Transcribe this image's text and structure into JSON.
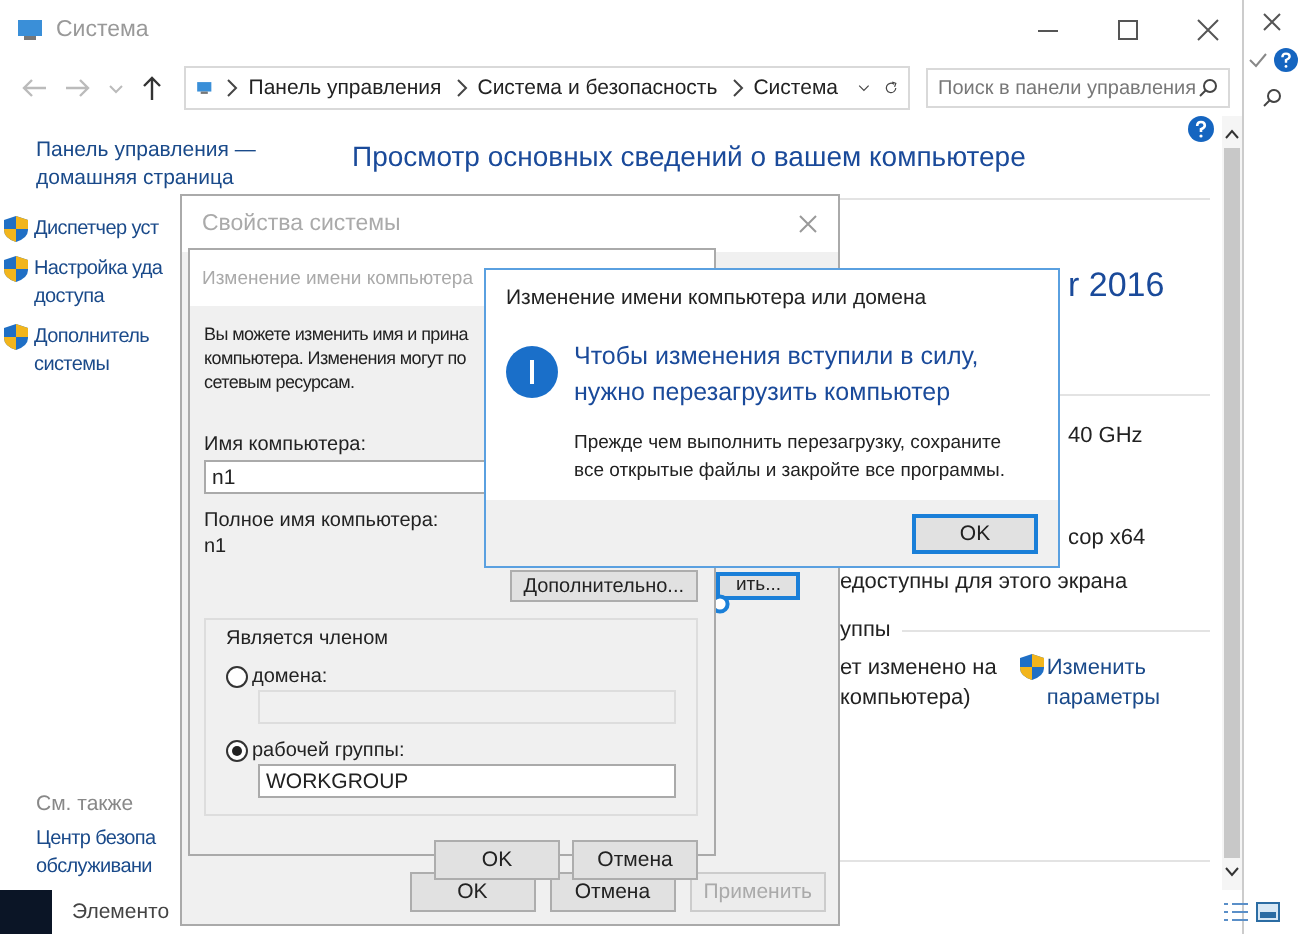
{
  "window": {
    "title": "Система"
  },
  "address_bar": {
    "breadcrumb": [
      "Панель управления",
      "Система и безопасность",
      "Система"
    ]
  },
  "search": {
    "placeholder": "Поиск в панели управления"
  },
  "sidebar": {
    "home_link": "Панель управления —\nдомашняя страница",
    "items": [
      "Диспетчер уст",
      "Настройка уда\nдоступа",
      "Дополнитель\nсистемы"
    ],
    "see_also_title": "См. также",
    "see_also_items": [
      "Центр безопа\nобслуживани"
    ]
  },
  "main": {
    "heading": "Просмотр основных сведений о вашем компьютере",
    "fragments": [
      {
        "kind": "title",
        "text": "r 2016"
      },
      {
        "kind": "value",
        "text": "40 GHz"
      },
      {
        "kind": "value",
        "text": "сор x64"
      },
      {
        "kind": "text",
        "text": "едоступны для этого экрана"
      },
      {
        "kind": "section",
        "text": "уппы"
      },
      {
        "kind": "text",
        "text": "ет изменено на\nкомпьютера)"
      }
    ],
    "link": "Изменить\nпараметры"
  },
  "status_bar": {
    "text": "Элементо"
  },
  "system_properties": {
    "title": "Свойства системы",
    "partial_button": "ить...",
    "buttons": [
      {
        "label": "OK",
        "disabled": false
      },
      {
        "label": "Отмена",
        "disabled": false
      },
      {
        "label": "Применить",
        "disabled": true
      }
    ]
  },
  "name_dialog": {
    "title": "Изменение имени компьютера",
    "intro": "Вы можете изменить имя и прина\nкомпьютера. Изменения могут по\nсетевым ресурсам.",
    "name_label": "Имя компьютера:",
    "name_value": "n1",
    "full_name_label": "Полное имя компьютера:",
    "full_name_value": "n1",
    "more_button": "Дополнительно...",
    "member_group": "Является членом",
    "options": [
      {
        "label": "домена:",
        "selected": false,
        "disabled": true
      },
      {
        "label": "рабочей группы:",
        "selected": true,
        "value": "WORKGROUP",
        "disabled": false
      }
    ],
    "buttons": [
      "OK",
      "Отмена"
    ]
  },
  "message": {
    "title": "Изменение имени компьютера или домена",
    "main": "Чтобы изменения вступили в силу,\nнужно перезагрузить компьютер",
    "detail": "Прежде чем выполнить перезагрузку, сохраните\nвсе открытые файлы и закройте все программы.",
    "button": "OK"
  }
}
